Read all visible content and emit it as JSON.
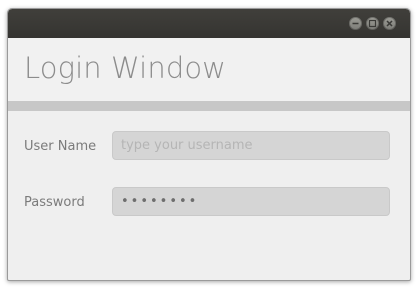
{
  "window": {
    "title": "Login Window",
    "controls": {
      "minimize_icon": "minimize-icon",
      "maximize_icon": "maximize-icon",
      "close_icon": "close-icon"
    }
  },
  "form": {
    "username_label": "User Name",
    "username_placeholder": "type your username",
    "username_value": "",
    "password_label": "Password",
    "password_masked": "••••••••"
  },
  "colors": {
    "titlebar": "#3c3b37",
    "window_bg": "#efefef",
    "divider": "#c7c7c7",
    "field_bg": "#d5d5d5"
  }
}
